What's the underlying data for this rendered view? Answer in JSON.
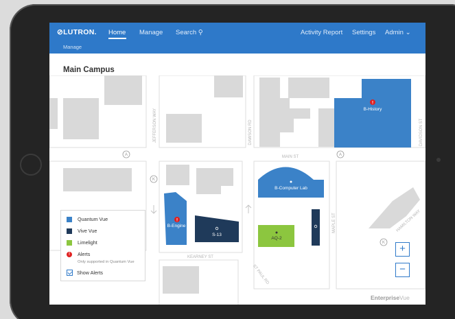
{
  "header": {
    "logo": "⊘LUTRON.",
    "nav_home": "Home",
    "nav_manage": "Manage",
    "nav_search": "Search ⚲",
    "nav_activity": "Activity Report",
    "nav_settings": "Settings",
    "nav_admin": "Admin ⌄",
    "subnav": "Manage"
  },
  "page": {
    "title": "Main Campus"
  },
  "map": {
    "streets": {
      "jefferson": "JEFFERSON WAY",
      "dawson_rd": "DAWSON RD",
      "main": "MAIN ST",
      "davidson": "DAVIDSON ST",
      "kearney": "KEARNEY ST",
      "st_paul": "ST PAUL RD",
      "maple": "MAPLE ST",
      "hamilton": "HAMILTON WAY"
    },
    "markers": {
      "a": "A",
      "k": "K"
    },
    "buildings": {
      "b_history": "B-History",
      "b_computer_lab": "B-Computer Lab",
      "b_engine": "B-Engine",
      "s13": "S-13",
      "aq2": "AQ-2"
    },
    "alert_glyph": "!"
  },
  "legend": {
    "quantum_vue": "Quantum Vue",
    "vive_vue": "Vive Vue",
    "limelight": "Limelight",
    "alerts": "Alerts",
    "alerts_note": "Only supported in Quantum Vue",
    "show_alerts": "Show Alerts"
  },
  "zoom": {
    "in": "+",
    "out": "−"
  },
  "brand": {
    "bold": "Enterprise",
    "light": "Vue"
  },
  "colors": {
    "topbar": "#2e79c9",
    "quantum_vue": "#3b82c8",
    "vive_vue": "#1f3a5a",
    "limelight": "#8cc63f",
    "alert": "#e02020",
    "building_gray": "#d9d9d9"
  }
}
